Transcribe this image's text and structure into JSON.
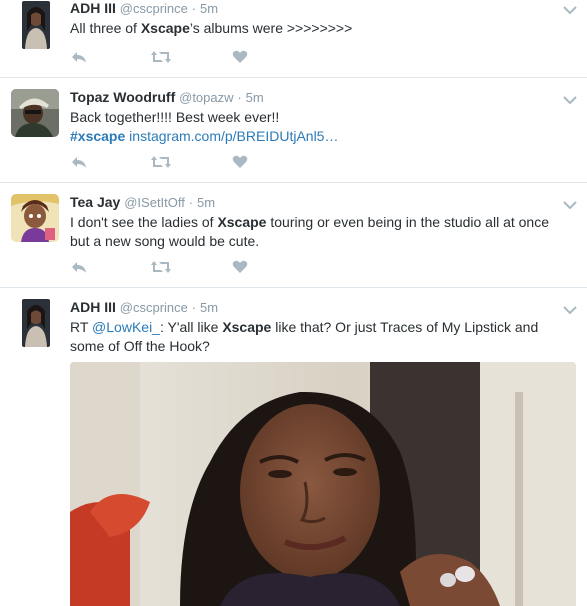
{
  "tweets": [
    {
      "name": "ADH III",
      "handle": "@cscprince",
      "sep": "·",
      "time": "5m",
      "text_pre": "All three of ",
      "text_bold": "Xscape",
      "text_post": "’s albums were >>>>>>>>"
    },
    {
      "name": "Topaz Woodruff",
      "handle": "@topazw",
      "sep": "·",
      "time": "5m",
      "line1": "Back together!!!! Best week ever!!",
      "hashtag": "#xscape",
      "link": "instagram.com/p/BREIDUtjAnl5…"
    },
    {
      "name": "Tea Jay",
      "handle": "@ISetItOff",
      "sep": "·",
      "time": "5m",
      "text_pre": "I don't see the ladies of ",
      "text_bold": "Xscape",
      "text_post": " touring or even being in the studio all at once but a new song would be cute."
    },
    {
      "name": "ADH III",
      "handle": "@cscprince",
      "sep": "·",
      "time": "5m",
      "rt": "RT ",
      "mention": "@LowKei_",
      "text_mid": ": Y'all like ",
      "text_bold": "Xscape",
      "text_post": " like that? Or just Traces of My Lipstick and some of Off the Hook?"
    }
  ],
  "icons": {
    "reply": "reply-icon",
    "retweet": "retweet-icon",
    "like": "heart-icon",
    "menu": "chevron-down-icon"
  },
  "colors": {
    "link": "#2b7bb9",
    "muted": "#8899a6",
    "icon": "#aab8c2",
    "divider": "#e1e8ed"
  }
}
